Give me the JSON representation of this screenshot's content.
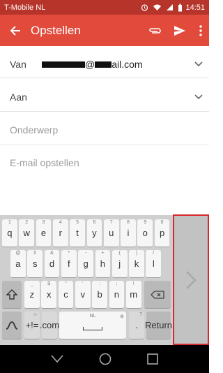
{
  "status": {
    "carrier": "T-Mobile  NL",
    "time": "14:51"
  },
  "toolbar": {
    "title": "Opstellen"
  },
  "form": {
    "from_label": "Van",
    "from_value_suffix": "@",
    "from_value_domain": "ail.com",
    "to_label": "Aan",
    "subject_placeholder": "Onderwerp",
    "body_placeholder": "E-mail opstellen"
  },
  "keyboard": {
    "row1": [
      {
        "k": "q",
        "h": "1"
      },
      {
        "k": "w",
        "h": "2"
      },
      {
        "k": "e",
        "h": "3"
      },
      {
        "k": "r",
        "h": "4"
      },
      {
        "k": "t",
        "h": "5"
      },
      {
        "k": "y",
        "h": "6"
      },
      {
        "k": "u",
        "h": "7"
      },
      {
        "k": "i",
        "h": "8"
      },
      {
        "k": "o",
        "h": "9"
      },
      {
        "k": "p",
        "h": "0"
      }
    ],
    "row2": [
      {
        "k": "a",
        "h": "@"
      },
      {
        "k": "s",
        "h": "#"
      },
      {
        "k": "d",
        "h": "&"
      },
      {
        "k": "f",
        "h": "*"
      },
      {
        "k": "g",
        "h": "-"
      },
      {
        "k": "h",
        "h": "+"
      },
      {
        "k": "j",
        "h": "("
      },
      {
        "k": "k",
        "h": ")"
      },
      {
        "k": "l",
        "h": "/"
      }
    ],
    "row3": [
      {
        "k": "z",
        "h": "_"
      },
      {
        "k": "x",
        "h": "$"
      },
      {
        "k": "c",
        "h": "\""
      },
      {
        "k": "v",
        "h": "'"
      },
      {
        "k": "b",
        "h": ":"
      },
      {
        "k": "n",
        "h": ";"
      },
      {
        "k": "m",
        "h": "!"
      }
    ],
    "symbols_label": "+!=",
    "symbols_hint": "☺",
    "dotcom_label": ".com",
    "space_label": "NL",
    "space_hint": "⊕",
    "period_label": ".",
    "period_hint": "?",
    "return_label": "Return"
  }
}
